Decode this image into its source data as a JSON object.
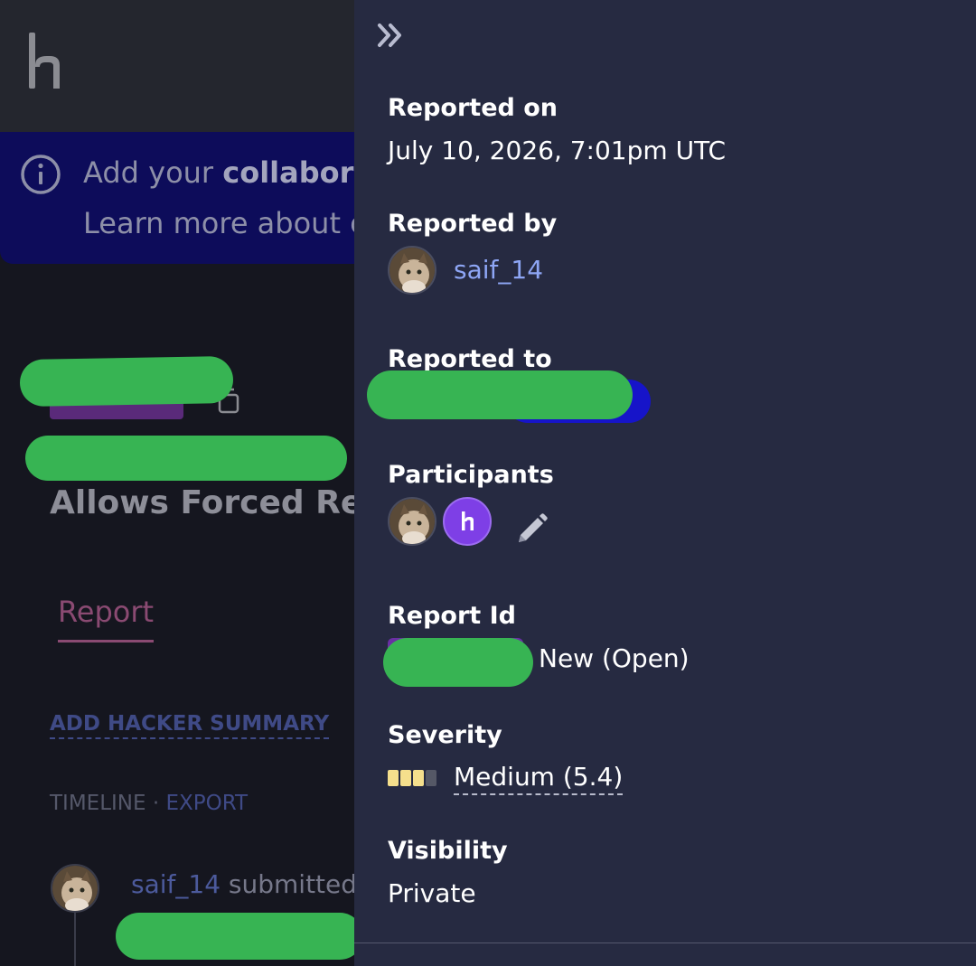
{
  "left": {
    "banner": {
      "line1_prefix": "Add your ",
      "line1_bold": "collaborat",
      "line2": "Learn more about c"
    },
    "title_line2": "Allows Forced Requ",
    "tab_report": "Report",
    "add_summary": "ADD HACKER SUMMARY",
    "timeline_label": "TIMELINE",
    "timeline_sep": " · ",
    "timeline_export": "EXPORT",
    "activity_user": "saif_14",
    "activity_text": " submitted"
  },
  "panel": {
    "reported_on_label": "Reported on",
    "reported_on_value": "July 10, 2026, 7:01pm UTC",
    "reported_by_label": "Reported by",
    "reporter_name": "saif_14",
    "reported_to_label": "Reported to",
    "participants_label": "Participants",
    "report_id_label": "Report Id",
    "report_status": "New (Open)",
    "severity_label": "Severity",
    "severity_value": "Medium (5.4)",
    "severity_level_filled": 3,
    "severity_level_total": 4,
    "visibility_label": "Visibility",
    "visibility_value": "Private"
  },
  "colors": {
    "panel_bg": "#262a41",
    "link": "#8ea6f5",
    "severity_yellow": "#f5df8c",
    "severity_grey": "#555866",
    "redaction": "#37b453"
  },
  "icons": {
    "collapse": "double-chevron-right-icon",
    "info": "info-circle-icon",
    "edit": "pencil-icon",
    "copy": "copy-icon"
  }
}
